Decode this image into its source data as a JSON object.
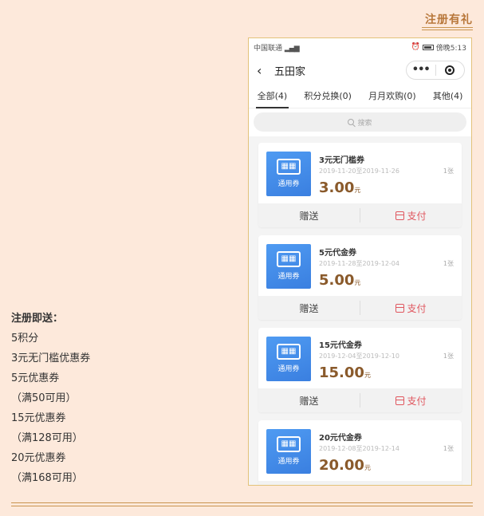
{
  "section": {
    "title": "注册有礼"
  },
  "promo": {
    "heading": "注册即送：",
    "lines": [
      "5积分",
      "3元无门槛优惠券",
      "5元优惠券",
      "（满50可用）",
      "15元优惠券",
      "（满128可用）",
      "20元优惠券",
      "（满168可用）"
    ]
  },
  "phone": {
    "status": {
      "carrier": "中国联通",
      "time": "傍晚5:13"
    },
    "nav": {
      "title": "五田家"
    },
    "tabs": [
      "全部(4)",
      "积分兑换(0)",
      "月月欢购(0)",
      "其他(4)"
    ],
    "search": {
      "placeholder": "搜索"
    },
    "coupons": [
      {
        "name": "3元无门槛券",
        "date": "2019-11-20至2019-11-26",
        "count": "1张",
        "price": "3.00",
        "unit": "元",
        "badge": "通用券",
        "gift": "赠送",
        "pay": "支付"
      },
      {
        "name": "5元代金券",
        "date": "2019-11-28至2019-12-04",
        "count": "1张",
        "price": "5.00",
        "unit": "元",
        "badge": "通用券",
        "gift": "赠送",
        "pay": "支付"
      },
      {
        "name": "15元代金券",
        "date": "2019-12-04至2019-12-10",
        "count": "1张",
        "price": "15.00",
        "unit": "元",
        "badge": "通用券",
        "gift": "赠送",
        "pay": "支付"
      },
      {
        "name": "20元代金券",
        "date": "2019-12-08至2019-12-14",
        "count": "1张",
        "price": "20.00",
        "unit": "元",
        "badge": "通用券",
        "gift": "赠送",
        "pay": "支付"
      }
    ]
  }
}
